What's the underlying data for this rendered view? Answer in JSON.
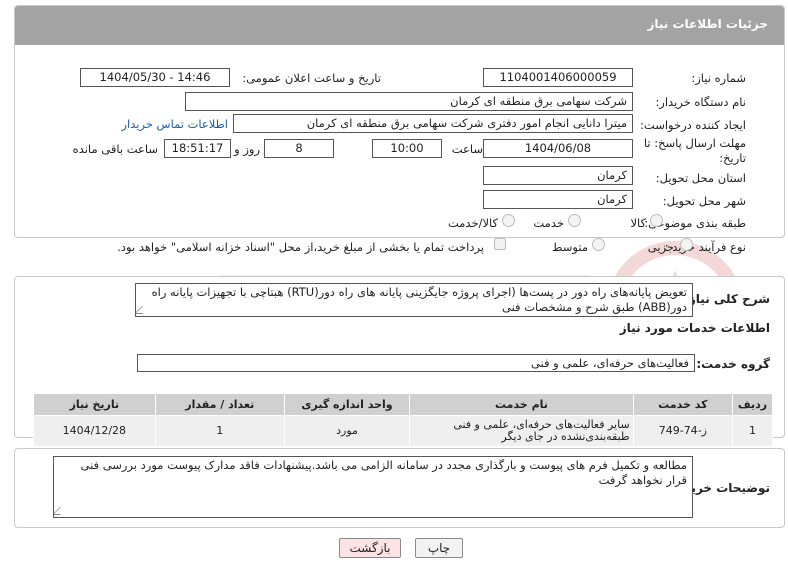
{
  "header": {
    "title": "جزئیات اطلاعات نیاز"
  },
  "fields": {
    "need_number_label": "شماره نیاز:",
    "need_number": "1104001406000059",
    "announce_label": "تاریخ و ساعت اعلان عمومی:",
    "announce_value": "1404/05/30 - 14:46",
    "buyer_org_label": "نام دستگاه خریدار:",
    "buyer_org": "شرکت سهامی برق منطقه ای کرمان",
    "creator_label": "ایجاد کننده درخواست:",
    "creator": "میترا دانایی انجام امور دفتری شرکت سهامی برق منطقه ای کرمان",
    "contact_link": "اطلاعات تماس خریدار",
    "deadline_label_1": "مهلت ارسال پاسخ: تا",
    "deadline_label_2": "تاریخ:",
    "deadline_date": "1404/06/08",
    "time_label": "ساعت",
    "deadline_time": "10:00",
    "days_value": "8",
    "days_label": "روز و",
    "remaining_time": "18:51:17",
    "remaining_label": "ساعت باقی مانده",
    "province_label": "استان محل تحویل:",
    "province": "کرمان",
    "city_label": "شهر محل تحویل:",
    "city": "کرمان",
    "category_label": "طبقه بندی موضوعی:",
    "category_options": [
      "کالا",
      "خدمت",
      "کالا/خدمت"
    ],
    "process_label": "نوع فرآیند خرید :",
    "process_options": [
      "جزیی",
      "متوسط"
    ],
    "payment_note": "پرداخت تمام یا بخشی از مبلغ خرید،از محل \"اسناد خزانه اسلامی\" خواهد بود."
  },
  "description": {
    "label": "شرح کلی نیاز:",
    "text": "تعویض پایانه‌های راه دور در پست‌ها (اجرای پروژه جایگزینی پایانه های راه دور(RTU) هبتاچی با تجهیزات پایانه راه دور(ABB) طبق شرح و مشخصات فنی"
  },
  "services": {
    "section_title": "اطلاعات خدمات مورد نیاز",
    "group_label": "گروه خدمت:",
    "group_value": "فعالیت‌های حرفه‌ای، علمی و فنی"
  },
  "table": {
    "headers": [
      "ردیف",
      "کد خدمت",
      "نام خدمت",
      "واحد اندازه گیری",
      "تعداد / مقدار",
      "تاریخ نیاز"
    ],
    "rows": [
      [
        "1",
        "ز-74-749",
        "سایر فعالیت‌های حرفه‌ای، علمی و فنی طبقه‌بندی‌نشده در جای دیگر",
        "مورد",
        "1",
        "1404/12/28"
      ]
    ]
  },
  "buyer_notes": {
    "label": "توضیحات خریدار:",
    "text": "مطالعه و تکمیل فرم های پیوست و بارگذاری مجدد در سامانه الزامی می باشد.پیشنهادات فاقد مدارک پیوست مورد بررسی فنی قرار نخواهد گرفت"
  },
  "buttons": {
    "print": "چاپ",
    "back": "بازگشت"
  },
  "colors": {
    "header_bg": "#a3a3a3",
    "link": "#1a5fb4",
    "back_bg": "#fde3e3"
  }
}
